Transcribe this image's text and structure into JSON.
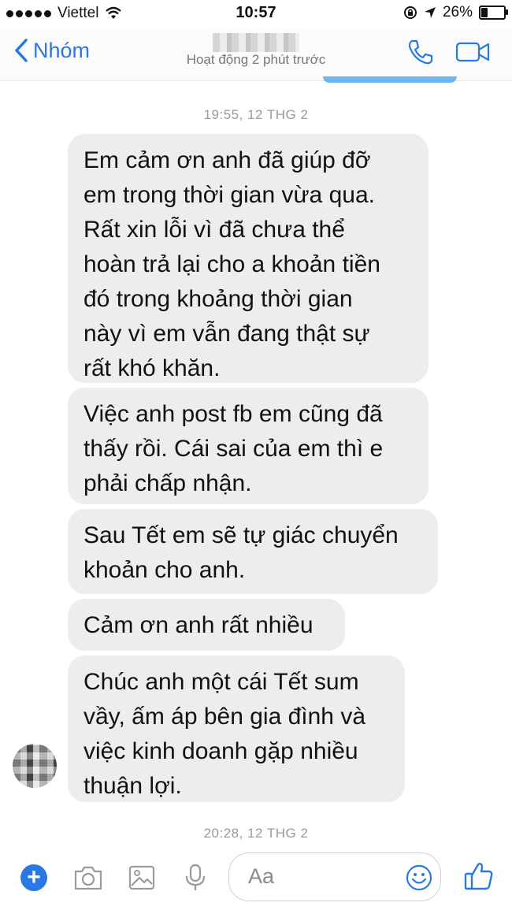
{
  "status_bar": {
    "carrier": "Viettel",
    "time": "10:57",
    "battery": "26%",
    "battery_fraction": 0.26
  },
  "header": {
    "back_label": "Nhóm",
    "subtitle": "Hoạt động 2 phút trước"
  },
  "conversation": {
    "timestamp_top": "19:55, 12 THG 2",
    "messages": [
      {
        "text": "Em cảm ơn anh đã giúp đỡ\nem trong thời gian vừa qua.\nRất xin lỗi vì đã chưa thể\nhoàn trả lại cho a khoản tiền\nđó trong khoảng thời gian\nnày vì em vẫn đang thật sự\nrất khó khăn."
      },
      {
        "text": "Việc anh post fb em cũng đã\nthấy rồi. Cái sai của em thì e\nphải chấp nhận."
      },
      {
        "text": "Sau Tết em sẽ tự giác chuyển\nkhoản cho anh."
      },
      {
        "text": "Cảm ơn anh rất nhiều"
      },
      {
        "text": "Chúc anh một cái Tết sum\nvầy, ấm áp bên gia đình và\nviệc kinh doanh gặp nhiều\nthuận lợi."
      }
    ],
    "timestamp_bottom": "20:28, 12 THG 2"
  },
  "composer": {
    "placeholder": "Aa",
    "icons": [
      "plus-icon",
      "camera-icon",
      "photo-icon",
      "microphone-icon",
      "emoji-icon",
      "thumbs-up-icon"
    ]
  },
  "colors": {
    "accent": "#2a78e4",
    "bubble": "#ededed",
    "timestamp": "#9a9a9a"
  }
}
